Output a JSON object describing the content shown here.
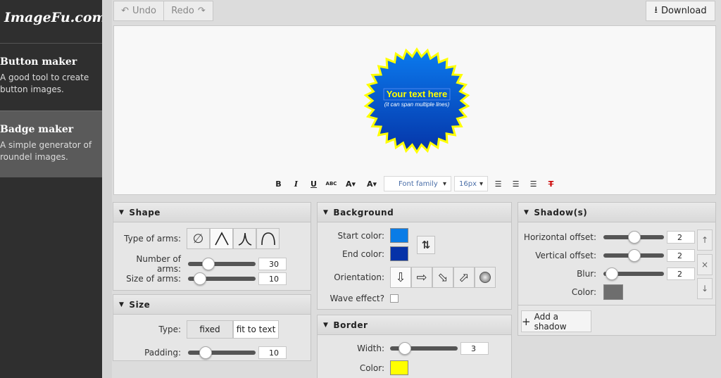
{
  "app": {
    "logo": "ImageFu.com"
  },
  "sidebar": {
    "items": [
      {
        "title": "Button maker",
        "desc": "A good tool to create button images."
      },
      {
        "title": "Badge maker",
        "desc": "A simple generator of roundel images."
      }
    ]
  },
  "toolbar": {
    "undo": "Undo",
    "redo": "Redo",
    "download": "Download"
  },
  "badge": {
    "main_text": "Your text here",
    "sub_text": "(it can span multiple lines)",
    "fill_top": "#0b7bef",
    "fill_bottom": "#0535a8",
    "border_color": "#ffff00",
    "text_color": "#ffff00"
  },
  "format_bar": {
    "bold": "B",
    "italic": "I",
    "underline": "U",
    "strike": "ABC",
    "font_family": "Font family",
    "font_size": "16px"
  },
  "shape": {
    "title": "Shape",
    "type_label": "Type of arms:",
    "count_label": "Number of arms:",
    "count_value": "30",
    "count_level": 0.25,
    "size_label": "Size of arms:",
    "size_value": "10",
    "size_level": 0.1
  },
  "size": {
    "title": "Size",
    "type_label": "Type:",
    "option_fixed": "fixed",
    "option_fit": "fit to text",
    "padding_label": "Padding:",
    "padding_value": "10",
    "padding_level": 0.2
  },
  "background": {
    "title": "Background",
    "start_label": "Start color:",
    "start_color": "#0a7ce6",
    "end_label": "End color:",
    "end_color": "#0632a8",
    "orientation_label": "Orientation:",
    "wave_label": "Wave effect?"
  },
  "border": {
    "title": "Border",
    "width_label": "Width:",
    "width_value": "3",
    "width_level": 0.15,
    "color_label": "Color:",
    "color": "#ffff00"
  },
  "shadows": {
    "title": "Shadow(s)",
    "h_label": "Horizontal offset:",
    "h_value": "2",
    "h_level": 0.52,
    "v_label": "Vertical offset:",
    "v_value": "2",
    "v_level": 0.52,
    "blur_label": "Blur:",
    "blur_value": "2",
    "blur_level": 0.05,
    "color_label": "Color:",
    "color": "#6e6e6e",
    "add_label": "Add a shadow"
  }
}
